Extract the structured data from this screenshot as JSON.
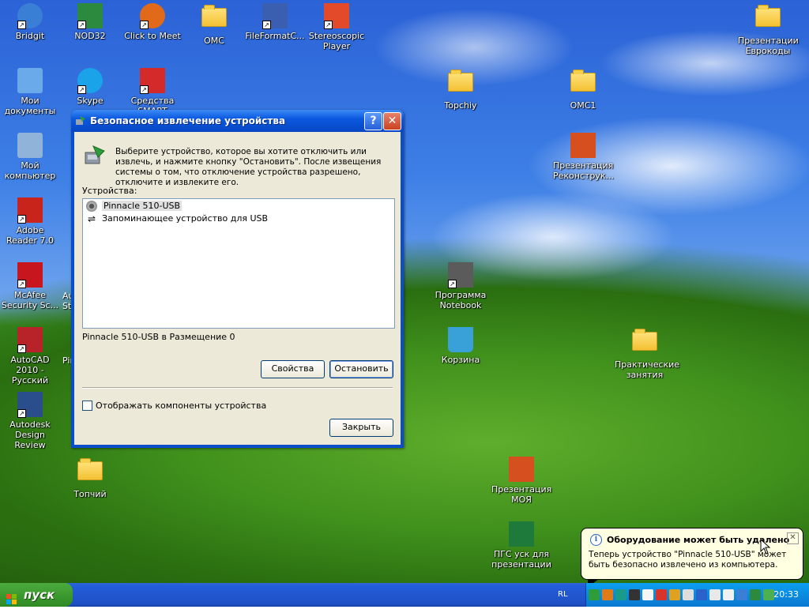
{
  "desktop": {
    "icons": [
      {
        "label": "Bridgit",
        "icon": "bridgit-icon",
        "color": "#3a7fd6"
      },
      {
        "label": "NOD32",
        "icon": "nod32-icon",
        "color": "#2b8a3e"
      },
      {
        "label": "Click to Meet",
        "icon": "click-to-meet-icon",
        "color": "#e06a1a"
      },
      {
        "label": "ОМС",
        "icon": "folder-icon"
      },
      {
        "label": "FileFormatC...",
        "icon": "fileformat-icon",
        "color": "#3b5fb0"
      },
      {
        "label": "Stereoscopic Player",
        "icon": "stereoscopic-player-icon",
        "color": "#e24a2a"
      },
      {
        "label": "Презентации Еврокоды",
        "icon": "folder-icon"
      },
      {
        "label": "Мои документы",
        "icon": "my-documents-icon",
        "color": "#6aa9ea"
      },
      {
        "label": "Skype",
        "icon": "skype-icon",
        "color": "#1aa3e8"
      },
      {
        "label": "Средства SMART",
        "icon": "smart-tools-icon",
        "color": "#d42a2a"
      },
      {
        "label": "Topchiy",
        "icon": "folder-icon"
      },
      {
        "label": "ОМС1",
        "icon": "folder-icon"
      },
      {
        "label": "Мой компьютер",
        "icon": "my-computer-icon",
        "color": "#8fb3d9"
      },
      {
        "label": "Презентация Реконструк...",
        "icon": "powerpoint-icon",
        "color": "#d6501f"
      },
      {
        "label": "Adobe Reader 7.0",
        "icon": "adobe-reader-icon",
        "color": "#c8241c"
      },
      {
        "label": "McAfee Security Sc...",
        "icon": "mcafee-icon",
        "color": "#c8161e"
      },
      {
        "label": "Программа Notebook",
        "icon": "notebook-icon",
        "color": "#5b5b5b"
      },
      {
        "label": "AutoCAD 2010 - Русский",
        "icon": "autocad-icon",
        "color": "#b8232a"
      },
      {
        "label": "Корзина",
        "icon": "recycle-bin-icon",
        "color": "#3aa0d8"
      },
      {
        "label": "Практические занятия",
        "icon": "folder-icon"
      },
      {
        "label": "Autodesk Design Review",
        "icon": "design-review-icon",
        "color": "#2a4e8c"
      },
      {
        "label": "Топчий",
        "icon": "folder-icon"
      },
      {
        "label": "Презентация МОЯ",
        "icon": "powerpoint-icon",
        "color": "#d6501f"
      },
      {
        "label": "ПГС уск для презентации",
        "icon": "excel-icon",
        "color": "#1d7a3a"
      }
    ],
    "partial_labels": [
      "Au",
      "St",
      "Pin"
    ]
  },
  "dialog": {
    "title": "Безопасное извлечение устройства",
    "help_label": "?",
    "close_label": "✕",
    "instructions": "Выберите устройство, которое вы хотите отключить или извлечь, и нажмите кнопку \"Остановить\". После извещения системы о том, что отключение устройства разрешено, отключите и извлеките его.",
    "devices_label": "Устройства:",
    "devices": [
      {
        "name": "Pinnacle 510-USB",
        "icon": "camera-device-icon",
        "selected": true
      },
      {
        "name": "Запоминающее устройство для USB",
        "icon": "usb-icon",
        "selected": false
      }
    ],
    "location_text": "Pinnacle 510-USB в Размещение 0",
    "properties_label": "Свойства",
    "stop_label": "Остановить",
    "show_components_label": "Отображать компоненты устройства",
    "show_components_checked": false,
    "close_button_label": "Закрыть"
  },
  "balloon": {
    "title": "Оборудование может быть удалено",
    "text": "Теперь устройство \"Pinnacle 510-USB\" может быть безопасно извлечено из компьютера.",
    "close_label": "✕",
    "info_label": "i"
  },
  "taskbar": {
    "start_label": "пуск",
    "language": "RL",
    "clock": "20:33",
    "tray_icons": [
      {
        "icon": "safely-remove-hardware-icon",
        "color": "#2f9c3a"
      },
      {
        "icon": "tray-app-icon-1",
        "color": "#e07b1a"
      },
      {
        "icon": "tray-app-icon-2",
        "color": "#1a9a8a"
      },
      {
        "icon": "tray-app-icon-3",
        "color": "#333333"
      },
      {
        "icon": "tray-app-icon-4",
        "color": "#f5f5f5"
      },
      {
        "icon": "tray-app-icon-5",
        "color": "#d9342b"
      },
      {
        "icon": "tray-app-icon-6",
        "color": "#e0a020"
      },
      {
        "icon": "volume-icon",
        "color": "#dddddd"
      },
      {
        "icon": "tray-app-icon-7",
        "color": "#2a62c9"
      },
      {
        "icon": "tray-app-icon-8",
        "color": "#e8e8e8"
      },
      {
        "icon": "tray-app-icon-9",
        "color": "#f0f0f0"
      },
      {
        "icon": "tray-app-icon-10",
        "color": "#3a7fd6"
      },
      {
        "icon": "network-icon",
        "color": "#2b8a3e"
      },
      {
        "icon": "tray-app-icon-11",
        "color": "#4caf50"
      }
    ]
  }
}
